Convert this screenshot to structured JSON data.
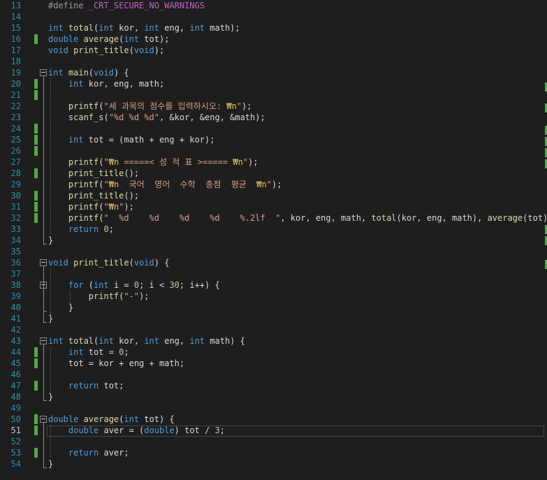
{
  "editor": {
    "current_line": 51,
    "lines": [
      {
        "n": "13",
        "segs": [
          {
            "t": "#define ",
            "c": "pp"
          },
          {
            "t": "_CRT_SECURE_NO_WARNINGS",
            "c": "mac"
          }
        ]
      },
      {
        "n": "14",
        "segs": []
      },
      {
        "n": "15",
        "segs": [
          {
            "t": "int ",
            "c": "kw"
          },
          {
            "t": "total",
            "c": "fn"
          },
          {
            "t": "(",
            "c": ""
          },
          {
            "t": "int",
            "c": "kw"
          },
          {
            "t": " kor, ",
            "c": ""
          },
          {
            "t": "int",
            "c": "kw"
          },
          {
            "t": " eng, ",
            "c": ""
          },
          {
            "t": "int",
            "c": "kw"
          },
          {
            "t": " math);",
            "c": ""
          }
        ]
      },
      {
        "n": "16",
        "segs": [
          {
            "t": "double ",
            "c": "kw"
          },
          {
            "t": "average",
            "c": "fn"
          },
          {
            "t": "(",
            "c": ""
          },
          {
            "t": "int",
            "c": "kw"
          },
          {
            "t": " tot);",
            "c": ""
          }
        ]
      },
      {
        "n": "17",
        "segs": [
          {
            "t": "void ",
            "c": "kw"
          },
          {
            "t": "print_title",
            "c": "fn"
          },
          {
            "t": "(",
            "c": ""
          },
          {
            "t": "void",
            "c": "kw"
          },
          {
            "t": ");",
            "c": ""
          }
        ]
      },
      {
        "n": "18",
        "segs": []
      },
      {
        "n": "19",
        "segs": [
          {
            "t": "int ",
            "c": "kw"
          },
          {
            "t": "main",
            "c": "fn"
          },
          {
            "t": "(",
            "c": ""
          },
          {
            "t": "void",
            "c": "kw"
          },
          {
            "t": ") {",
            "c": ""
          }
        ]
      },
      {
        "n": "20",
        "segs": [
          {
            "t": "    int",
            "c": "kw"
          },
          {
            "t": " kor, eng, math;",
            "c": ""
          }
        ]
      },
      {
        "n": "21",
        "segs": []
      },
      {
        "n": "22",
        "segs": [
          {
            "t": "    printf",
            "c": "fn"
          },
          {
            "t": "(",
            "c": ""
          },
          {
            "t": "\"세 과목의 점수를 입력하시오: ",
            "c": "str"
          },
          {
            "t": "₩n",
            "c": "esc"
          },
          {
            "t": "\"",
            "c": "str"
          },
          {
            "t": ");",
            "c": ""
          }
        ]
      },
      {
        "n": "23",
        "segs": [
          {
            "t": "    scanf_s",
            "c": "fn"
          },
          {
            "t": "(",
            "c": ""
          },
          {
            "t": "\"%d %d %d\"",
            "c": "str"
          },
          {
            "t": ", &kor, &eng, &math);",
            "c": ""
          }
        ]
      },
      {
        "n": "24",
        "segs": []
      },
      {
        "n": "25",
        "segs": [
          {
            "t": "    int",
            "c": "kw"
          },
          {
            "t": " tot = (math + eng + kor);",
            "c": ""
          }
        ]
      },
      {
        "n": "26",
        "segs": []
      },
      {
        "n": "27",
        "segs": [
          {
            "t": "    printf",
            "c": "fn"
          },
          {
            "t": "(",
            "c": ""
          },
          {
            "t": "\"",
            "c": "str"
          },
          {
            "t": "₩n",
            "c": "esc"
          },
          {
            "t": " =====< 성 적 표 >===== ",
            "c": "str"
          },
          {
            "t": "₩n",
            "c": "esc"
          },
          {
            "t": "\"",
            "c": "str"
          },
          {
            "t": ");",
            "c": ""
          }
        ]
      },
      {
        "n": "28",
        "segs": [
          {
            "t": "    print_title",
            "c": "fn"
          },
          {
            "t": "();",
            "c": ""
          }
        ]
      },
      {
        "n": "29",
        "segs": [
          {
            "t": "    printf",
            "c": "fn"
          },
          {
            "t": "(",
            "c": ""
          },
          {
            "t": "\"",
            "c": "str"
          },
          {
            "t": "₩n",
            "c": "esc"
          },
          {
            "t": "  국어  영어  수학  총점  평균  ",
            "c": "str"
          },
          {
            "t": "₩n",
            "c": "esc"
          },
          {
            "t": "\"",
            "c": "str"
          },
          {
            "t": ");",
            "c": ""
          }
        ]
      },
      {
        "n": "30",
        "segs": [
          {
            "t": "    print_title",
            "c": "fn"
          },
          {
            "t": "();",
            "c": ""
          }
        ]
      },
      {
        "n": "31",
        "segs": [
          {
            "t": "    printf",
            "c": "fn"
          },
          {
            "t": "(",
            "c": ""
          },
          {
            "t": "\"",
            "c": "str"
          },
          {
            "t": "₩n",
            "c": "esc"
          },
          {
            "t": "\"",
            "c": "str"
          },
          {
            "t": ");",
            "c": ""
          }
        ]
      },
      {
        "n": "32",
        "segs": [
          {
            "t": "    printf",
            "c": "fn"
          },
          {
            "t": "(",
            "c": ""
          },
          {
            "t": "\"  %d    %d    %d    %d    %.2lf  \"",
            "c": "str"
          },
          {
            "t": ", kor, eng, math, ",
            "c": ""
          },
          {
            "t": "total",
            "c": "fn"
          },
          {
            "t": "(kor, eng, math), ",
            "c": ""
          },
          {
            "t": "average",
            "c": "fn"
          },
          {
            "t": "(tot));",
            "c": ""
          }
        ]
      },
      {
        "n": "33",
        "segs": [
          {
            "t": "    return ",
            "c": "kw"
          },
          {
            "t": "0",
            "c": "num"
          },
          {
            "t": ";",
            "c": ""
          }
        ]
      },
      {
        "n": "34",
        "segs": [
          {
            "t": "}",
            "c": ""
          }
        ]
      },
      {
        "n": "35",
        "segs": []
      },
      {
        "n": "36",
        "segs": [
          {
            "t": "void ",
            "c": "kw"
          },
          {
            "t": "print_title",
            "c": "fn"
          },
          {
            "t": "(",
            "c": ""
          },
          {
            "t": "void",
            "c": "kw"
          },
          {
            "t": ") {",
            "c": ""
          }
        ]
      },
      {
        "n": "37",
        "segs": []
      },
      {
        "n": "38",
        "segs": [
          {
            "t": "    for",
            "c": "kw"
          },
          {
            "t": " (",
            "c": ""
          },
          {
            "t": "int",
            "c": "kw"
          },
          {
            "t": " i = ",
            "c": ""
          },
          {
            "t": "0",
            "c": "num"
          },
          {
            "t": "; i < ",
            "c": ""
          },
          {
            "t": "30",
            "c": "num"
          },
          {
            "t": "; i++) {",
            "c": ""
          }
        ]
      },
      {
        "n": "39",
        "segs": [
          {
            "t": "        printf",
            "c": "fn"
          },
          {
            "t": "(",
            "c": ""
          },
          {
            "t": "\"-\"",
            "c": "str"
          },
          {
            "t": ");",
            "c": ""
          }
        ]
      },
      {
        "n": "40",
        "segs": [
          {
            "t": "    }",
            "c": ""
          }
        ]
      },
      {
        "n": "41",
        "segs": [
          {
            "t": "}",
            "c": ""
          }
        ]
      },
      {
        "n": "42",
        "segs": []
      },
      {
        "n": "43",
        "segs": [
          {
            "t": "int ",
            "c": "kw"
          },
          {
            "t": "total",
            "c": "fn"
          },
          {
            "t": "(",
            "c": ""
          },
          {
            "t": "int",
            "c": "kw"
          },
          {
            "t": " kor, ",
            "c": ""
          },
          {
            "t": "int",
            "c": "kw"
          },
          {
            "t": " eng, ",
            "c": ""
          },
          {
            "t": "int",
            "c": "kw"
          },
          {
            "t": " math) {",
            "c": ""
          }
        ]
      },
      {
        "n": "44",
        "segs": [
          {
            "t": "    int",
            "c": "kw"
          },
          {
            "t": " tot = ",
            "c": ""
          },
          {
            "t": "0",
            "c": "num"
          },
          {
            "t": ";",
            "c": ""
          }
        ]
      },
      {
        "n": "45",
        "segs": [
          {
            "t": "    tot = kor + eng + math;",
            "c": ""
          }
        ]
      },
      {
        "n": "46",
        "segs": []
      },
      {
        "n": "47",
        "segs": [
          {
            "t": "    return",
            "c": "kw"
          },
          {
            "t": " tot;",
            "c": ""
          }
        ]
      },
      {
        "n": "48",
        "segs": [
          {
            "t": "}",
            "c": ""
          }
        ]
      },
      {
        "n": "49",
        "segs": []
      },
      {
        "n": "50",
        "segs": [
          {
            "t": "double ",
            "c": "kw"
          },
          {
            "t": "average",
            "c": "fn"
          },
          {
            "t": "(",
            "c": ""
          },
          {
            "t": "int",
            "c": "kw"
          },
          {
            "t": " tot) {",
            "c": ""
          }
        ]
      },
      {
        "n": "51",
        "segs": [
          {
            "t": "    double",
            "c": "kw"
          },
          {
            "t": " aver = (",
            "c": ""
          },
          {
            "t": "double",
            "c": "kw"
          },
          {
            "t": ") tot / ",
            "c": ""
          },
          {
            "t": "3",
            "c": "num"
          },
          {
            "t": ";",
            "c": ""
          }
        ]
      },
      {
        "n": "52",
        "segs": []
      },
      {
        "n": "53",
        "segs": [
          {
            "t": "    return",
            "c": "kw"
          },
          {
            "t": " aver;",
            "c": ""
          }
        ]
      },
      {
        "n": "54",
        "segs": [
          {
            "t": "}",
            "c": ""
          }
        ]
      }
    ]
  }
}
